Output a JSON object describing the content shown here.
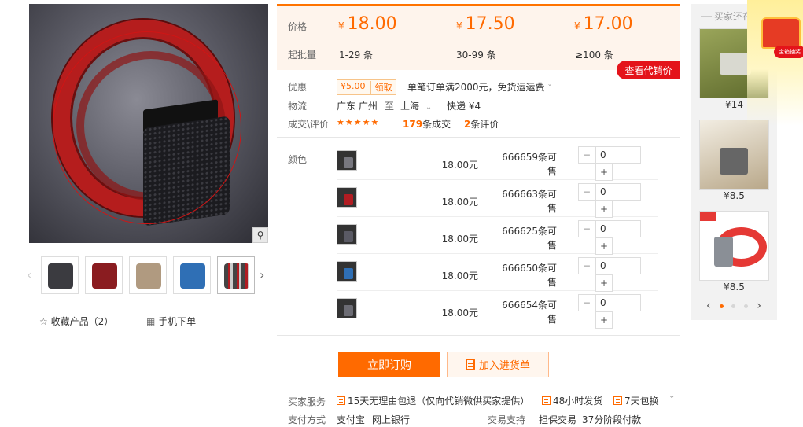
{
  "zoom_icon": "magnifier-icon",
  "gallery_colors": [
    "#3b3b40",
    "#8a1c20",
    "#b09a80",
    "#2f6fb5",
    "#444"
  ],
  "actions": {
    "favorite": "收藏产品（2）",
    "mobile": "手机下单"
  },
  "price": {
    "price_label": "价格",
    "moq_label": "起批量",
    "currency": "¥",
    "tiers": [
      {
        "price": "18.00",
        "range": "1-29 条"
      },
      {
        "price": "17.50",
        "range": "30-99 条"
      },
      {
        "price": "17.00",
        "range": "≥100 条"
      }
    ],
    "check_btn": "查看代销价"
  },
  "info": {
    "promo_label": "优惠",
    "coupon_value": "¥5.00",
    "coupon_get": "领取",
    "promo_text": "单笔订单满2000元，免货运运费",
    "logistics_label": "物流",
    "from": "广东 广州",
    "to_word": "至",
    "to": "上海",
    "express": "快递 ¥4",
    "deal_label": "成交\\评价",
    "stars": "★★★★★",
    "deals_count": "179",
    "deals_unit": "条成交",
    "reviews_count": "2",
    "reviews_unit": "条评价"
  },
  "sku": {
    "label": "颜色",
    "price_unit": "元",
    "stock_unit": "条可售",
    "rows": [
      {
        "price": "18.00",
        "stock": "666659",
        "qty": "0",
        "color": "#3b3b40"
      },
      {
        "price": "18.00",
        "stock": "666663",
        "qty": "0",
        "color": "#b11c22"
      },
      {
        "price": "18.00",
        "stock": "666625",
        "qty": "0",
        "color": "#4a4a52"
      },
      {
        "price": "18.00",
        "stock": "666650",
        "qty": "0",
        "color": "#2f6fb5"
      },
      {
        "price": "18.00",
        "stock": "666654",
        "qty": "0",
        "color": "#55555c"
      }
    ]
  },
  "buttons": {
    "order": "立即订购",
    "cart": "加入进货单"
  },
  "service": {
    "label": "买家服务",
    "items": [
      "15天无理由包退（仅向代销微供买家提供）",
      "48小时发货",
      "7天包换"
    ],
    "pay_label": "支付方式",
    "pay_items": [
      "支付宝",
      "网上银行"
    ],
    "trade_label": "交易支持",
    "trade_items": [
      "担保交易",
      "37分阶段付款"
    ]
  },
  "side": {
    "title": "买家还在看",
    "items": [
      {
        "price": "¥14",
        "color": "#6f7a3a"
      },
      {
        "price": "¥8.5",
        "color": "#b9a88a"
      },
      {
        "price": "¥8.5",
        "color": "#e53935"
      }
    ]
  },
  "promo_text": "宝箱抽奖"
}
